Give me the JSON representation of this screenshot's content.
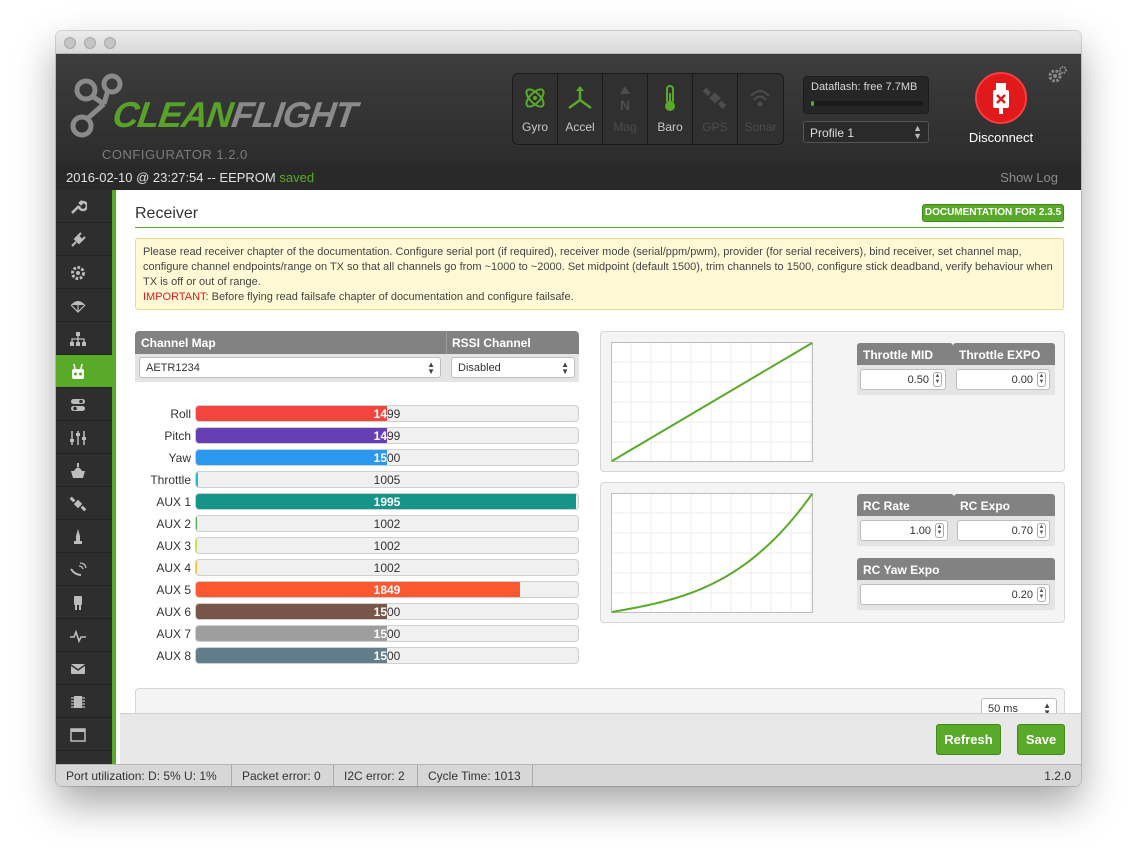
{
  "app": {
    "logo_brand": "CLEANFLIGHT",
    "logo_sub": "CONFIGURATOR  1.2.0"
  },
  "sensors": [
    {
      "label": "Gyro",
      "active": true
    },
    {
      "label": "Accel",
      "active": true
    },
    {
      "label": "Mag",
      "active": false
    },
    {
      "label": "Baro",
      "active": true
    },
    {
      "label": "GPS",
      "active": false
    },
    {
      "label": "Sonar",
      "active": false
    }
  ],
  "dataflash": {
    "label": "Dataflash: free 7.7MB",
    "used_fraction": 0.03
  },
  "profile": {
    "selected": "Profile 1"
  },
  "connection": {
    "button_label": "Disconnect"
  },
  "status_line": {
    "prefix": "2016-02-10 @ 23:27:54 -- EEPROM",
    "saved": "saved",
    "show_log": "Show Log"
  },
  "sidebar": {
    "items": [
      {
        "icon": "wrench-icon",
        "active": false
      },
      {
        "icon": "power-plug-icon",
        "active": false
      },
      {
        "icon": "gear-icon",
        "active": false
      },
      {
        "icon": "parachute-icon",
        "active": false
      },
      {
        "icon": "hierarchy-icon",
        "active": false
      },
      {
        "icon": "receiver-icon",
        "active": true
      },
      {
        "icon": "toggle-modes-icon",
        "active": false
      },
      {
        "icon": "sliders-icon",
        "active": false
      },
      {
        "icon": "motor-icon",
        "active": false
      },
      {
        "icon": "satellite-icon",
        "active": false
      },
      {
        "icon": "led-icon",
        "active": false
      },
      {
        "icon": "sensor-icon",
        "active": false
      },
      {
        "icon": "servo-icon",
        "active": false
      },
      {
        "icon": "pulse-icon",
        "active": false
      },
      {
        "icon": "blackbox-icon",
        "active": false
      },
      {
        "icon": "chip-icon",
        "active": false
      },
      {
        "icon": "cli-icon",
        "active": false
      }
    ]
  },
  "receiver": {
    "title": "Receiver",
    "doc_button": "DOCUMENTATION FOR 2.3.5",
    "note": "Please read receiver chapter of the documentation. Configure serial port (if required), receiver mode (serial/ppm/pwm), provider (for serial receivers), bind receiver, set channel map, configure channel endpoints/range on TX so that all channels go from ~1000 to ~2000. Set midpoint (default 1500), trim channels to 1500, configure stick deadband, verify behaviour when TX is off or out of range.",
    "important_label": "IMPORTANT:",
    "important_text": " Before flying read failsafe chapter of documentation and configure failsafe.",
    "channel_map_header": "Channel Map",
    "channel_map_value": "AETR1234",
    "rssi_header": "RSSI Channel",
    "rssi_value": "Disabled",
    "channels": [
      {
        "name": "Roll",
        "value": 1499,
        "color": "#f1453d"
      },
      {
        "name": "Pitch",
        "value": 1499,
        "color": "#673fb4"
      },
      {
        "name": "Yaw",
        "value": 1500,
        "color": "#2b98f0"
      },
      {
        "name": "Throttle",
        "value": 1005,
        "color": "#1fbcd2"
      },
      {
        "name": "AUX 1",
        "value": 1995,
        "color": "#159588"
      },
      {
        "name": "AUX 2",
        "value": 1002,
        "color": "#50ae55"
      },
      {
        "name": "AUX 3",
        "value": 1002,
        "color": "#cdda49"
      },
      {
        "name": "AUX 4",
        "value": 1002,
        "color": "#fdc02f"
      },
      {
        "name": "AUX 5",
        "value": 1849,
        "color": "#fc5830"
      },
      {
        "name": "AUX 6",
        "value": 1500,
        "color": "#785549"
      },
      {
        "name": "AUX 7",
        "value": 1500,
        "color": "#9e9e9e"
      },
      {
        "name": "AUX 8",
        "value": 1500,
        "color": "#617d8a"
      }
    ],
    "throttle_mid_label": "Throttle MID",
    "throttle_mid": "0.50",
    "throttle_expo_label": "Throttle EXPO",
    "throttle_expo": "0.00",
    "rc_rate_label": "RC Rate",
    "rc_rate": "1.00",
    "rc_expo_label": "RC Expo",
    "rc_expo": "0.70",
    "rc_yaw_expo_label": "RC Yaw Expo",
    "rc_yaw_expo": "0.20",
    "refresh_rate": "50 ms"
  },
  "footer": {
    "refresh": "Refresh",
    "save": "Save"
  },
  "statusbar": {
    "port_util": "Port utilization: D: 5% U: 1%",
    "packet_error": "Packet error: 0",
    "i2c_error": "I2C error: 2",
    "cycle_time": "Cycle Time: 1013",
    "version": "1.2.0"
  },
  "colors": {
    "accent": "#59aa29",
    "danger": "#e01a1a"
  }
}
